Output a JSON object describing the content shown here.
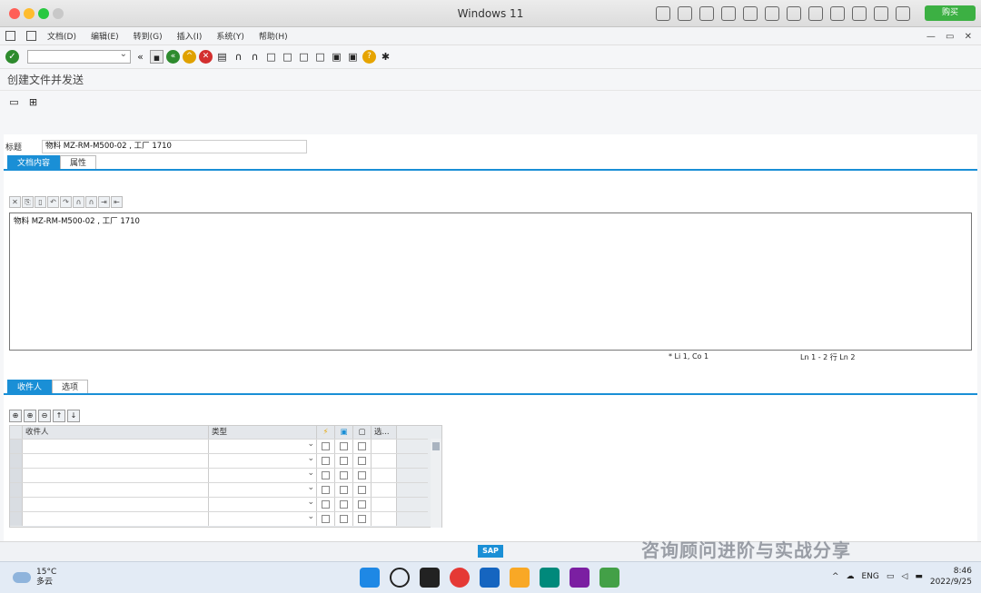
{
  "mac": {
    "window_title": "Windows 11",
    "buy_label": "购买"
  },
  "menu": {
    "items": [
      "文档(D)",
      "编辑(E)",
      "转到(G)",
      "插入(I)",
      "系统(Y)",
      "帮助(H)"
    ]
  },
  "page": {
    "title": "创建文件并发送"
  },
  "form": {
    "subject_label": "标题",
    "subject_value": "物料 MZ-RM-M500-02 , 工厂 1710"
  },
  "tabs_top": [
    "文档内容",
    "属性"
  ],
  "editor": {
    "text": "物料 MZ-RM-M500-02 , 工厂 1710",
    "status_pos": "*  Li 1, Co 1",
    "status_lines": "Ln 1 - 2 行 Ln 2"
  },
  "tabs_bottom": [
    "收件人",
    "选项"
  ],
  "grid": {
    "col_recipient": "收件人",
    "col_type": "类型",
    "col_sel": "选..."
  },
  "sap": {
    "logo": "SAP"
  },
  "watermark": "咨询顾问进阶与实战分享",
  "taskbar": {
    "temperature": "15°C",
    "weather": "多云",
    "lang": "ENG",
    "time": "8:46",
    "date": "2022/9/25"
  }
}
